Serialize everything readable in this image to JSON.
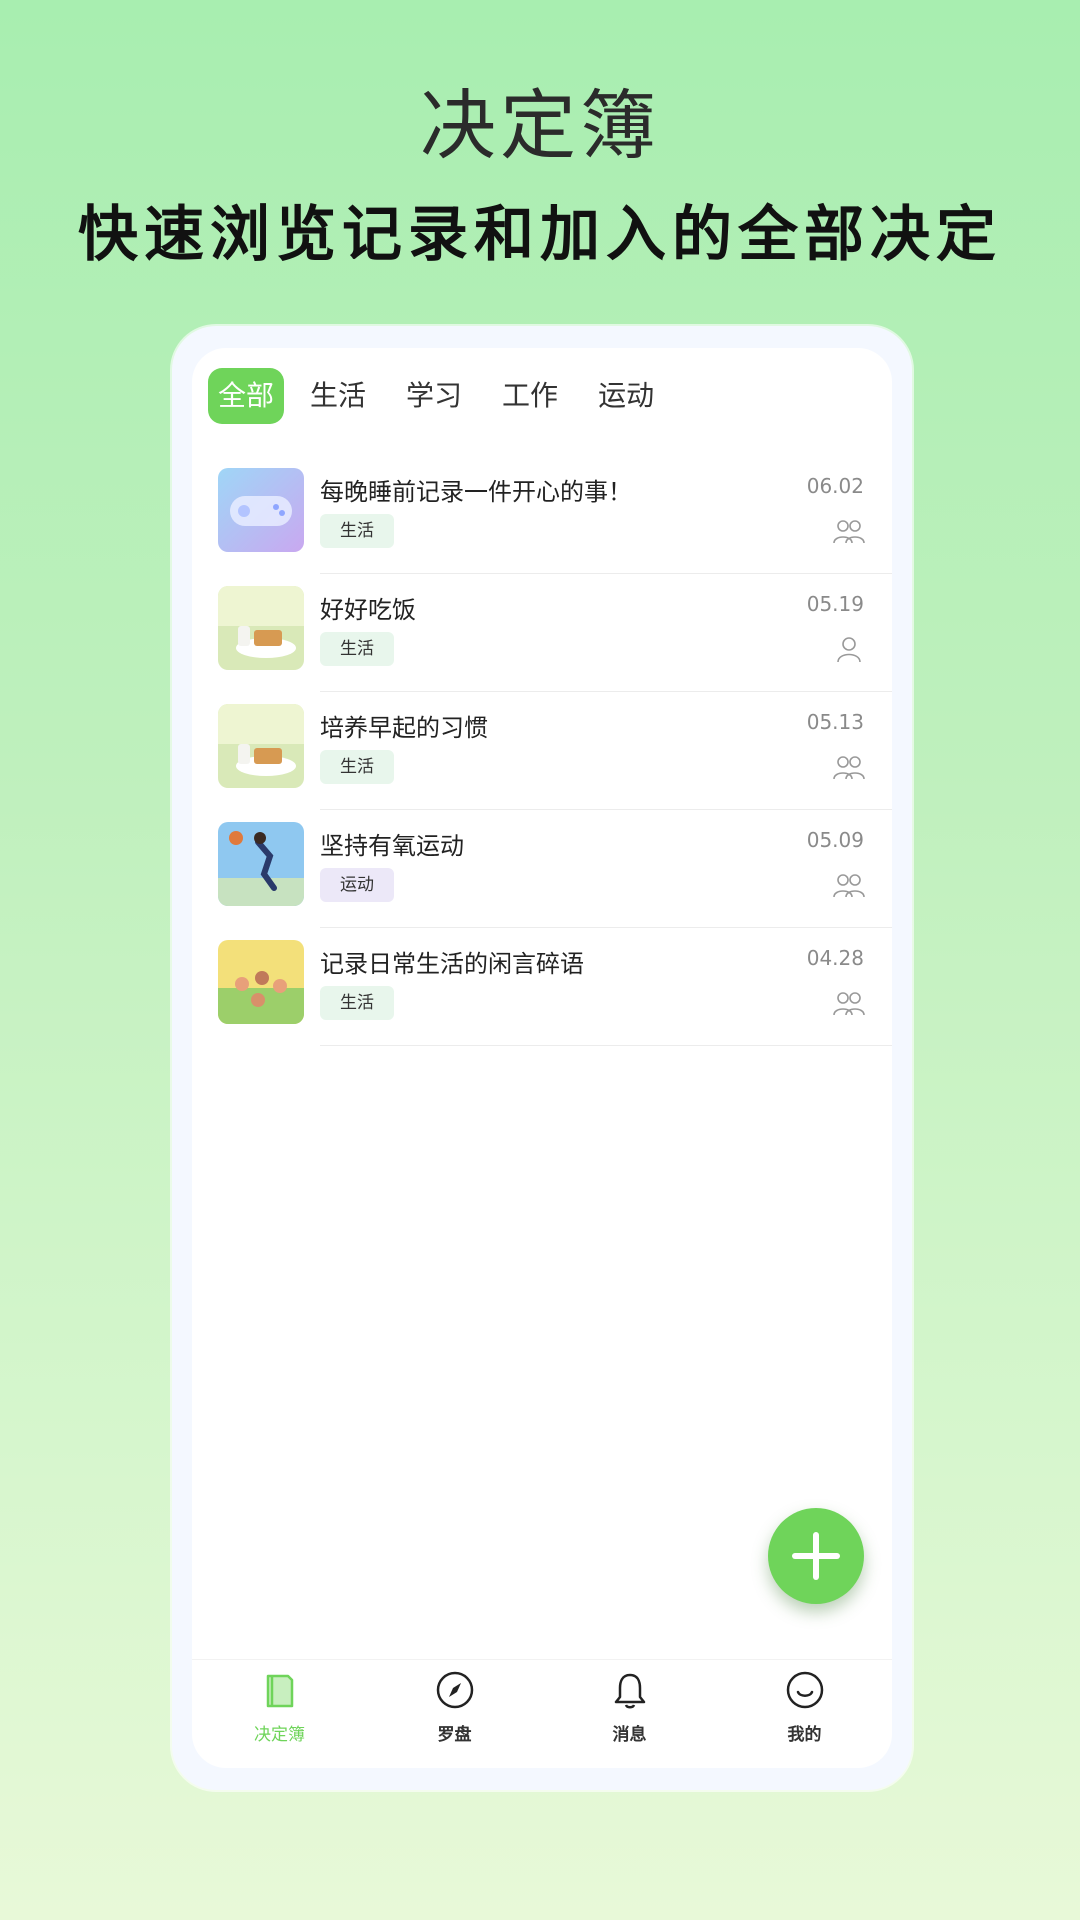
{
  "promo": {
    "title": "决定簿",
    "subtitle": "快速浏览记录和加入的全部决定"
  },
  "tabs": [
    {
      "label": "全部",
      "active": true
    },
    {
      "label": "生活"
    },
    {
      "label": "学习"
    },
    {
      "label": "工作"
    },
    {
      "label": "运动"
    }
  ],
  "items": [
    {
      "title": "每晚睡前记录一件开心的事！",
      "date": "06.02",
      "tag": "生活",
      "members": "group-icon"
    },
    {
      "title": "好好吃饭",
      "date": "05.19",
      "tag": "生活",
      "members": "person-icon"
    },
    {
      "title": "培养早起的习惯",
      "date": "05.13",
      "tag": "生活",
      "members": "group-icon"
    },
    {
      "title": "坚持有氧运动",
      "date": "05.09",
      "tag": "运动",
      "members": "group-icon"
    },
    {
      "title": "记录日常生活的闲言碎语",
      "date": "04.28",
      "tag": "生活",
      "members": "group-icon"
    }
  ],
  "nav": [
    {
      "label": "决定簿",
      "icon": "book-icon",
      "active": true
    },
    {
      "label": "罗盘",
      "icon": "compass-icon"
    },
    {
      "label": "消息",
      "icon": "bell-icon"
    },
    {
      "label": "我的",
      "icon": "smile-icon"
    }
  ],
  "colors": {
    "accent": "#6fd45a",
    "background_top": "#a8eeb0",
    "background_bottom": "#e8f9d8"
  }
}
